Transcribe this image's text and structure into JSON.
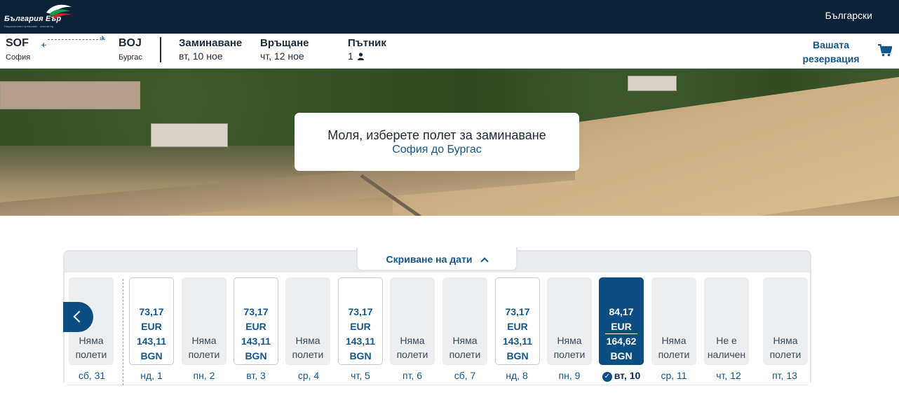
{
  "header": {
    "logo_text": "България Еър",
    "logo_tagline": "Националният превозвач · www.air.bg",
    "language": "Български"
  },
  "summary": {
    "origin_code": "SOF",
    "origin_city": "София",
    "destination_code": "BOJ",
    "destination_city": "Бургас",
    "departure_label": "Заминаване",
    "departure_value": "вт, 10 ное",
    "return_label": "Връщане",
    "return_value": "чт, 12 ное",
    "passenger_label": "Пътник",
    "passenger_count": "1",
    "booking_link": "Вашата резервация",
    "icons": {
      "cart": "cart-icon",
      "person": "person-icon",
      "plane": "plane-icon"
    }
  },
  "hero": {
    "title": "Моля, изберете полет за заминаване",
    "route": "София до Бургас"
  },
  "date_selector": {
    "toggle_label": "Скриване на дати",
    "days": [
      {
        "label": "сб, 31",
        "status": "none",
        "text": [
          "Няма",
          "полети"
        ]
      },
      {
        "label": "нд, 1",
        "status": "available",
        "eur": "73,17",
        "bgn": "143,11"
      },
      {
        "label": "пн, 2",
        "status": "none",
        "text": [
          "Няма",
          "полети"
        ]
      },
      {
        "label": "вт, 3",
        "status": "available",
        "eur": "73,17",
        "bgn": "143,11"
      },
      {
        "label": "ср, 4",
        "status": "none",
        "text": [
          "Няма",
          "полети"
        ]
      },
      {
        "label": "чт, 5",
        "status": "available",
        "eur": "73,17",
        "bgn": "143,11"
      },
      {
        "label": "пт, 6",
        "status": "none",
        "text": [
          "Няма",
          "полети"
        ]
      },
      {
        "label": "сб, 7",
        "status": "none",
        "text": [
          "Няма",
          "полети"
        ]
      },
      {
        "label": "нд, 8",
        "status": "available",
        "eur": "73,17",
        "bgn": "143,11"
      },
      {
        "label": "пн, 9",
        "status": "none",
        "text": [
          "Няма",
          "полети"
        ]
      },
      {
        "label": "вт, 10",
        "status": "selected",
        "eur": "84,17",
        "bgn": "164,62"
      },
      {
        "label": "ср, 11",
        "status": "none",
        "text": [
          "Няма",
          "полети"
        ]
      },
      {
        "label": "чт, 12",
        "status": "unavailable",
        "text": [
          "Не е",
          "наличен"
        ]
      },
      {
        "label": "пт, 13",
        "status": "none",
        "text": [
          "Няма",
          "полети"
        ]
      }
    ],
    "currency_eur": "EUR",
    "currency_bgn": "BGN",
    "colors": {
      "selected_bg": "#0b4f82",
      "price_text": "#12568c",
      "header_bg": "#0c2238"
    }
  }
}
